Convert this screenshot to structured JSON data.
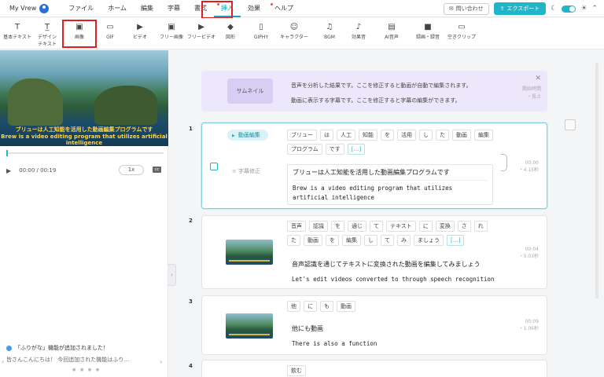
{
  "app": {
    "name": "My Vrew"
  },
  "menu": {
    "items": [
      {
        "label": "ファイル",
        "dot": false,
        "active": false
      },
      {
        "label": "ホーム",
        "dot": false,
        "active": false
      },
      {
        "label": "編集",
        "dot": false,
        "active": false
      },
      {
        "label": "字幕",
        "dot": false,
        "active": false
      },
      {
        "label": "書式",
        "dot": false,
        "active": false
      },
      {
        "label": "挿入",
        "dot": true,
        "active": true
      },
      {
        "label": "効果",
        "dot": false,
        "active": false
      },
      {
        "label": "ヘルプ",
        "dot": true,
        "active": false
      }
    ],
    "contact_label": "問い合わせ",
    "export_label": "エクスポート"
  },
  "toolbar": {
    "tools": [
      {
        "label": "基本テキスト",
        "icon": "text-icon"
      },
      {
        "label": "デザイン\nテキスト",
        "icon": "design-text-icon"
      },
      {
        "label": "画像",
        "icon": "image-icon"
      },
      {
        "label": "GIF",
        "icon": "gif-icon"
      },
      {
        "label": "ビデオ",
        "icon": "video-icon"
      },
      {
        "label": "フリー画像",
        "icon": "free-image-icon"
      },
      {
        "label": "フリービデオ",
        "icon": "free-video-icon"
      },
      {
        "label": "図形",
        "icon": "shape-icon"
      },
      {
        "label": "GIPHY",
        "icon": "giphy-icon"
      },
      {
        "label": "キャラクター",
        "icon": "character-icon"
      },
      {
        "label": "BGM",
        "icon": "music-icon"
      },
      {
        "label": "効果音",
        "icon": "sound-effect-icon"
      },
      {
        "label": "AI音声",
        "icon": "ai-voice-icon"
      },
      {
        "label": "録画・録音",
        "icon": "record-icon"
      },
      {
        "label": "空きクリップ",
        "icon": "empty-clip-icon"
      }
    ]
  },
  "player": {
    "subtitle_jp": "ブリューは人工知能を活用した動画編集プログラムです",
    "subtitle_en": "Brew is a video editing program that utilizes artificial intelligence",
    "time": "00:00 / 00:19",
    "speed": "1x",
    "progress": 0.0
  },
  "news": {
    "title": "「ふりがな」機能が追加されました！",
    "body": "皆さんこんにちは！ 今回追加された機能はふり…"
  },
  "banner": {
    "thumbnail_label": "サムネイル",
    "line1": "音声を分析した結果です。ここを修正すると動画が自動で編集されます。",
    "line2": "動画に表示する字幕です。ここを修正すると字幕の編集ができます。",
    "meta1": "開始時間",
    "meta2": "・長さ"
  },
  "clips": [
    {
      "number": "1",
      "edit_label": "動画編集",
      "subtitle_label": "字幕修正",
      "tokens": [
        "ブリュー",
        "は",
        "人工",
        "知能",
        "を",
        "活用",
        "し",
        "た",
        "動画",
        "編集",
        "プログラム",
        "です",
        "[…]"
      ],
      "jp": "ブリューは人工知能を活用した動画編集プログラムです",
      "en": "Brew is a video editing program that utilizes artificial intelligence",
      "start": "00:00",
      "length": "・4.15秒"
    },
    {
      "number": "2",
      "tokens": [
        "音声",
        "認識",
        "を",
        "通じ",
        "て",
        "テキスト",
        "に",
        "変換",
        "さ",
        "れ",
        "た",
        "動画",
        "を",
        "編集",
        "し",
        "て",
        "み",
        "ましょう",
        "[…]"
      ],
      "jp": "音声認識を通じてテキストに変換された動画を編集してみましょう",
      "en": "Let's edit videos converted to through speech recognition",
      "start": "00:04",
      "length": "・5.03秒"
    },
    {
      "number": "3",
      "tokens": [
        "他",
        "に",
        "も",
        "動画"
      ],
      "jp": "他にも動画",
      "en": "There is also a function",
      "start": "00:09",
      "length": "・1.06秒"
    },
    {
      "number": "4",
      "tokens": [
        "飲む"
      ]
    }
  ]
}
